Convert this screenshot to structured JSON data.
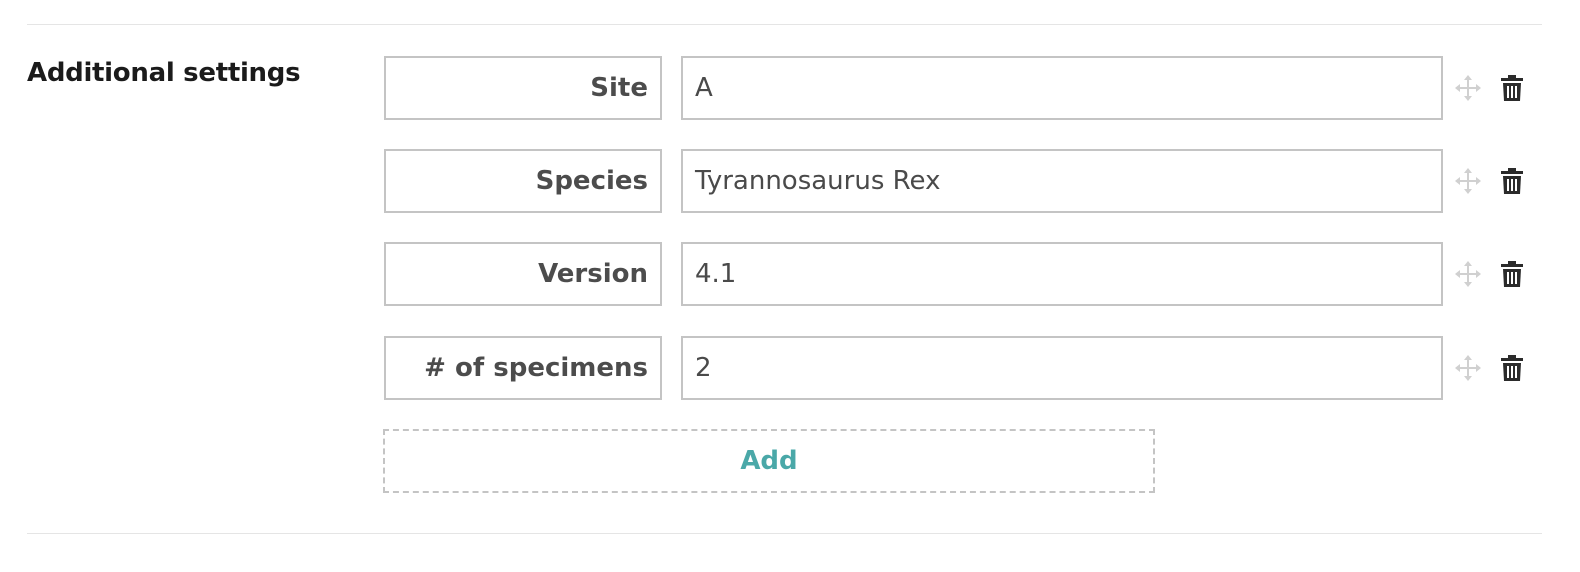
{
  "section": {
    "title": "Additional settings"
  },
  "settings": {
    "rows": [
      {
        "key": "Site",
        "value": "A"
      },
      {
        "key": "Species",
        "value": "Tyrannosaurus Rex"
      },
      {
        "key": "Version",
        "value": "4.1"
      },
      {
        "key": "# of specimens",
        "value": "2"
      }
    ],
    "add_label": "Add"
  },
  "icons": {
    "move": "move-icon",
    "delete": "trash-icon"
  },
  "colors": {
    "accent": "#4aa8a8",
    "border": "#c4c4c4",
    "icon_move": "#d0d0d0",
    "icon_delete": "#2b2b2b"
  }
}
